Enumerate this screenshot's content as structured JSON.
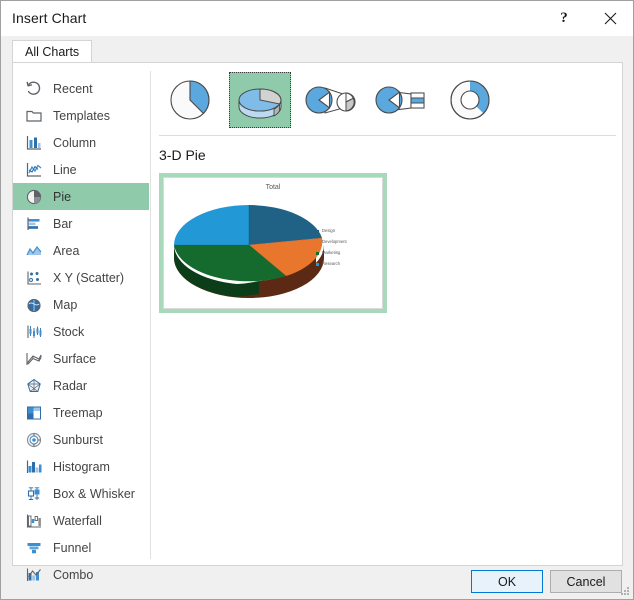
{
  "window": {
    "title": "Insert Chart",
    "help_icon": "question-mark-icon",
    "close_icon": "close-icon"
  },
  "tabs": [
    {
      "label": "All Charts",
      "selected": true
    }
  ],
  "sidebar": {
    "items": [
      {
        "label": "Recent",
        "icon": "recent-icon",
        "selected": false
      },
      {
        "label": "Templates",
        "icon": "templates-icon",
        "selected": false
      },
      {
        "label": "Column",
        "icon": "column-icon",
        "selected": false
      },
      {
        "label": "Line",
        "icon": "line-icon",
        "selected": false
      },
      {
        "label": "Pie",
        "icon": "pie-icon",
        "selected": true
      },
      {
        "label": "Bar",
        "icon": "bar-icon",
        "selected": false
      },
      {
        "label": "Area",
        "icon": "area-icon",
        "selected": false
      },
      {
        "label": "X Y (Scatter)",
        "icon": "scatter-icon",
        "selected": false
      },
      {
        "label": "Map",
        "icon": "map-icon",
        "selected": false
      },
      {
        "label": "Stock",
        "icon": "stock-icon",
        "selected": false
      },
      {
        "label": "Surface",
        "icon": "surface-icon",
        "selected": false
      },
      {
        "label": "Radar",
        "icon": "radar-icon",
        "selected": false
      },
      {
        "label": "Treemap",
        "icon": "treemap-icon",
        "selected": false
      },
      {
        "label": "Sunburst",
        "icon": "sunburst-icon",
        "selected": false
      },
      {
        "label": "Histogram",
        "icon": "histogram-icon",
        "selected": false
      },
      {
        "label": "Box & Whisker",
        "icon": "box-whisker-icon",
        "selected": false
      },
      {
        "label": "Waterfall",
        "icon": "waterfall-icon",
        "selected": false
      },
      {
        "label": "Funnel",
        "icon": "funnel-icon",
        "selected": false
      },
      {
        "label": "Combo",
        "icon": "combo-icon",
        "selected": false
      }
    ]
  },
  "chart_types": [
    {
      "name": "Pie",
      "icon": "pie-2d-icon",
      "selected": false
    },
    {
      "name": "3-D Pie",
      "icon": "pie-3d-icon",
      "selected": true
    },
    {
      "name": "Pie of Pie",
      "icon": "pie-of-pie-icon",
      "selected": false
    },
    {
      "name": "Bar of Pie",
      "icon": "bar-of-pie-icon",
      "selected": false
    },
    {
      "name": "Doughnut",
      "icon": "doughnut-icon",
      "selected": false
    }
  ],
  "preview": {
    "heading": "3-D Pie"
  },
  "chart_data": {
    "type": "pie",
    "title": "Total",
    "three_d": true,
    "categories": [
      "Design",
      "Development",
      "Marketing",
      "Research"
    ],
    "values": [
      25,
      17,
      37,
      21
    ],
    "colors": [
      "#1f6286",
      "#e8762c",
      "#156b2e",
      "#2299d6"
    ],
    "legend_position": "right",
    "legend": [
      {
        "label": "Design",
        "color": "#1f6286"
      },
      {
        "label": "Development",
        "color": "#e8762c"
      },
      {
        "label": "Marketing",
        "color": "#156b2e"
      },
      {
        "label": "Research",
        "color": "#2299d6"
      }
    ]
  },
  "footer": {
    "ok_label": "OK",
    "cancel_label": "Cancel"
  },
  "colors": {
    "selection_green": "#8fcbaa",
    "preview_border_green": "#a8d9ba",
    "accent_blue": "#0078d7"
  }
}
